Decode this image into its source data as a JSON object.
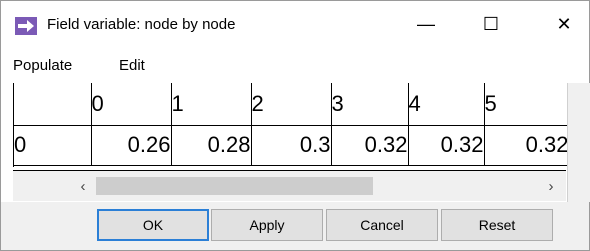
{
  "window": {
    "title": "Field variable: node by node",
    "minimize_glyph": "—",
    "maximize_glyph": "☐",
    "close_glyph": "✕"
  },
  "menu": {
    "items": [
      "Populate",
      "Edit"
    ]
  },
  "table": {
    "columns": [
      "0",
      "1",
      "2",
      "3",
      "4",
      "5"
    ],
    "rows": [
      {
        "header": "0",
        "values": [
          "0.26",
          "0.28",
          "0.3",
          "0.32",
          "0.32",
          "0.32"
        ]
      }
    ]
  },
  "scrollbar": {
    "left_glyph": "‹",
    "right_glyph": "›"
  },
  "buttons": {
    "ok": "OK",
    "apply": "Apply",
    "cancel": "Cancel",
    "reset": "Reset"
  },
  "colors": {
    "accent": "#7b5ab6",
    "ok_border": "#2b7fd6"
  }
}
